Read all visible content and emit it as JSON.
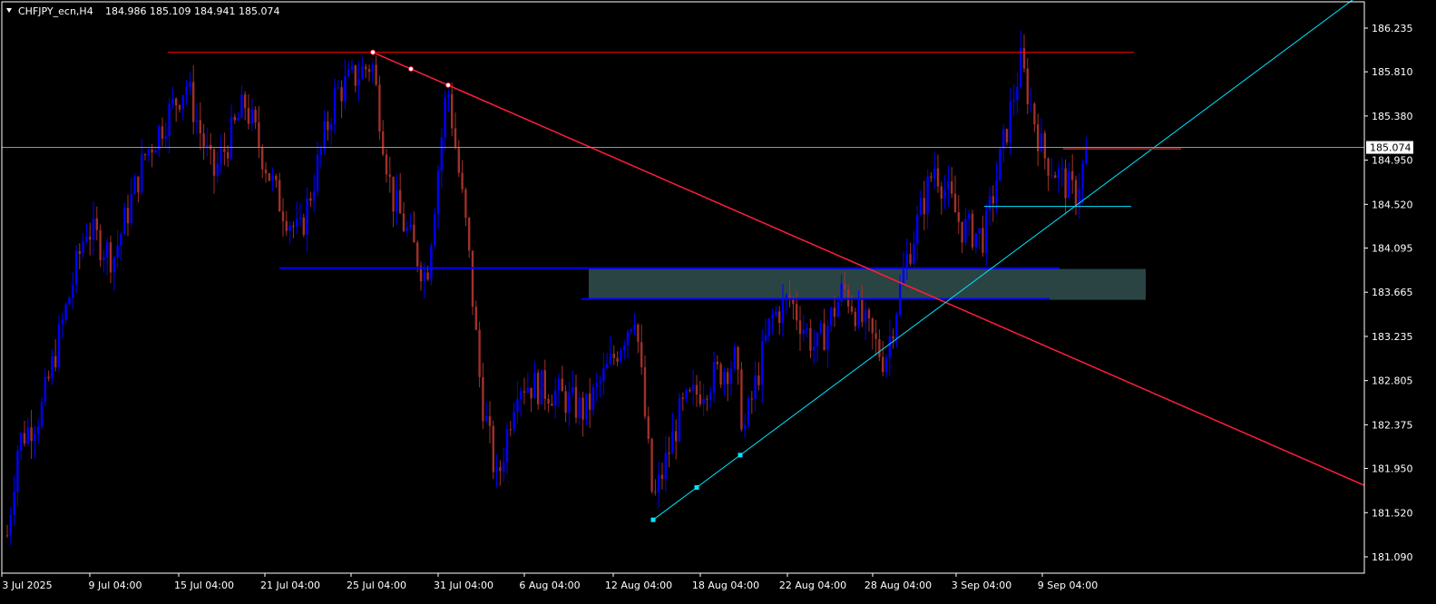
{
  "header": {
    "symbol": "CHFJPY_ecn,H4",
    "ohlc": "184.986 185.109 184.941 185.074"
  },
  "current_price": "185.074",
  "colors": {
    "background": "#000000",
    "frame": "#ffffff",
    "bull_candle": "#0000ff",
    "bear_candle": "#a0302a",
    "resistance_line": "#ff0000",
    "down_trendline": "#ff1e3c",
    "up_trendline": "#00e5ff",
    "support_line": "#0000ff",
    "zone_fill": "#2e4a4a",
    "price_line": "#8c96a5"
  },
  "chart_data": {
    "type": "candlestick",
    "symbol": "CHFJPY_ecn",
    "timeframe": "H4",
    "x_labels": [
      "3 Jul 2025",
      "9 Jul 04:00",
      "15 Jul 04:00",
      "21 Jul 04:00",
      "25 Jul 04:00",
      "31 Jul 04:00",
      "6 Aug 04:00",
      "12 Aug 04:00",
      "18 Aug 04:00",
      "22 Aug 04:00",
      "28 Aug 04:00",
      "3 Sep 04:00",
      "9 Sep 04:00"
    ],
    "y_ticks": [
      "186.235",
      "185.810",
      "185.380",
      "184.950",
      "184.520",
      "184.095",
      "183.665",
      "183.235",
      "182.805",
      "182.375",
      "181.950",
      "181.520",
      "181.090"
    ],
    "y_range": [
      181.0,
      186.4
    ],
    "last_price": 185.074,
    "series_anchors": [
      {
        "x": "3 Jul 2025",
        "price": 181.3
      },
      {
        "x": "5 Jul",
        "price": 182.2
      },
      {
        "x": "7 Jul",
        "price": 182.5
      },
      {
        "x": "9 Jul 04:00",
        "price": 184.3
      },
      {
        "x": "12 Jul",
        "price": 184.0
      },
      {
        "x": "14 Jul",
        "price": 185.0
      },
      {
        "x": "15 Jul 04:00",
        "price": 185.7
      },
      {
        "x": "17 Jul",
        "price": 184.8
      },
      {
        "x": "19 Jul",
        "price": 185.5
      },
      {
        "x": "21 Jul 04:00",
        "price": 184.6
      },
      {
        "x": "23 Jul",
        "price": 184.2
      },
      {
        "x": "24 Jul",
        "price": 185.6
      },
      {
        "x": "25 Jul 04:00",
        "price": 185.9
      },
      {
        "x": "27 Jul",
        "price": 184.6
      },
      {
        "x": "29 Jul",
        "price": 183.8
      },
      {
        "x": "30 Jul",
        "price": 185.7
      },
      {
        "x": "31 Jul 04:00",
        "price": 184.2
      },
      {
        "x": "2 Aug",
        "price": 182.7
      },
      {
        "x": "4 Aug",
        "price": 181.8
      },
      {
        "x": "5 Aug",
        "price": 182.8
      },
      {
        "x": "6 Aug 04:00",
        "price": 182.7
      },
      {
        "x": "8 Aug",
        "price": 182.5
      },
      {
        "x": "10 Aug",
        "price": 183.0
      },
      {
        "x": "11 Aug",
        "price": 183.5
      },
      {
        "x": "12 Aug 04:00",
        "price": 181.6
      },
      {
        "x": "14 Aug",
        "price": 182.5
      },
      {
        "x": "16 Aug",
        "price": 182.8
      },
      {
        "x": "18 Aug 04:00",
        "price": 183.0
      },
      {
        "x": "19 Aug",
        "price": 182.3
      },
      {
        "x": "21 Aug",
        "price": 183.4
      },
      {
        "x": "22 Aug 04:00",
        "price": 183.6
      },
      {
        "x": "24 Aug",
        "price": 183.1
      },
      {
        "x": "26 Aug",
        "price": 183.7
      },
      {
        "x": "28 Aug 04:00",
        "price": 183.0
      },
      {
        "x": "30 Aug",
        "price": 184.0
      },
      {
        "x": "1 Sep",
        "price": 184.9
      },
      {
        "x": "3 Sep 04:00",
        "price": 184.3
      },
      {
        "x": "5 Sep",
        "price": 184.2
      },
      {
        "x": "7 Sep",
        "price": 185.9
      },
      {
        "x": "8 Sep",
        "price": 185.0
      },
      {
        "x": "9 Sep 04:00",
        "price": 184.6
      },
      {
        "x": "10 Sep",
        "price": 185.074
      }
    ],
    "annotations": {
      "resistance_line": {
        "price": 186.0,
        "from": "15 Jul",
        "to": "12 Sep"
      },
      "down_trendline": {
        "from": {
          "x": "25 Jul 04:00",
          "price": 186.0
        },
        "through": {
          "x": "31 Jul 04:00",
          "price": 185.68
        }
      },
      "support_line": {
        "price": 183.9,
        "from": "21 Jul",
        "to": "9 Sep"
      },
      "demand_zone": {
        "top": 183.9,
        "bottom": 183.6,
        "from": "6 Aug",
        "to": "11 Sep"
      },
      "up_trendline": {
        "from": {
          "x": "12 Aug 04:00",
          "price": 181.45
        },
        "through": {
          "x": "18 Aug 04:00",
          "price": 182.08
        }
      },
      "swing_level_low": {
        "price": 184.5,
        "from": "3 Sep 04:00",
        "to": "11 Sep"
      },
      "swing_level_high": {
        "price": 185.06,
        "from": "9 Sep",
        "to": "12 Sep"
      }
    }
  }
}
